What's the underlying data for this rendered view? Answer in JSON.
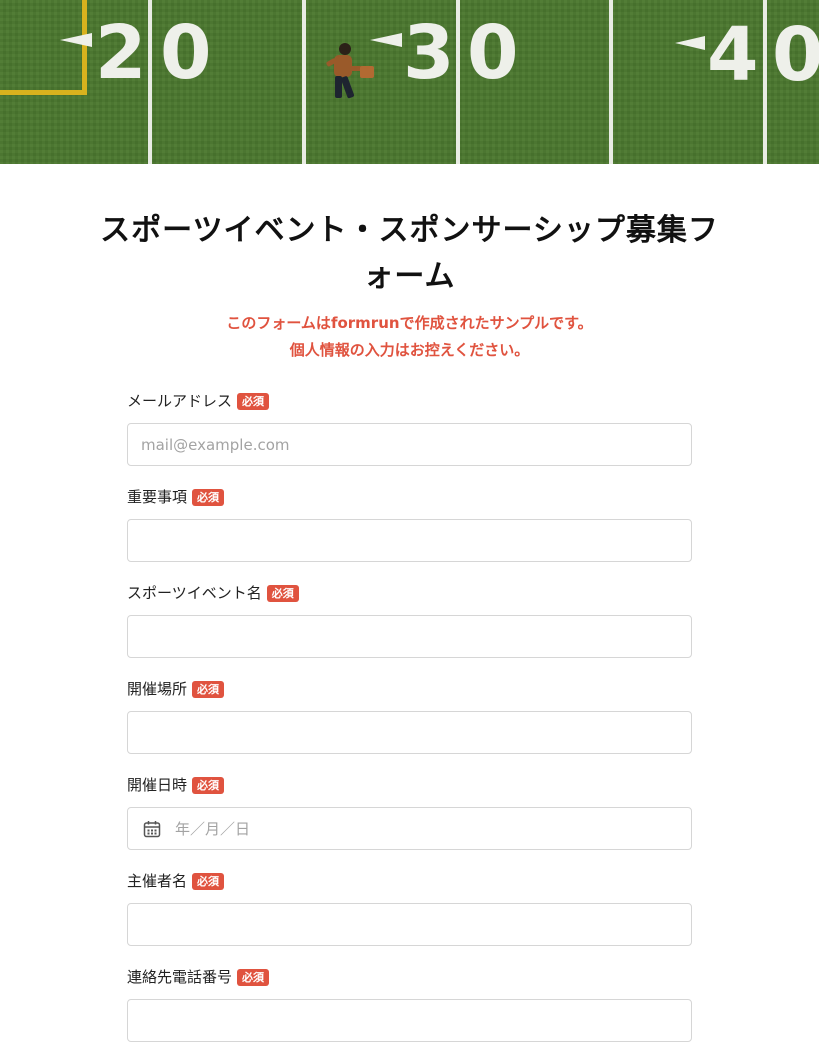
{
  "hero": {
    "yard_numbers": [
      "2",
      "0",
      "3",
      "0",
      "4",
      "0"
    ],
    "image_description_icon": "football-field-photo"
  },
  "header": {
    "title": "スポーツイベント・スポンサーシップ募集フォーム",
    "notice_line1_prefix": "このフォームは",
    "notice_line1_brand": "formrun",
    "notice_line1_suffix": "で作成されたサンプルです。",
    "notice_line2": "個人情報の入力はお控えください。"
  },
  "form": {
    "required_badge": "必須",
    "fields": [
      {
        "label": "メールアドレス",
        "placeholder": "mail@example.com",
        "type": "email"
      },
      {
        "label": "重要事項",
        "placeholder": "",
        "type": "text"
      },
      {
        "label": "スポーツイベント名",
        "placeholder": "",
        "type": "text"
      },
      {
        "label": "開催場所",
        "placeholder": "",
        "type": "text"
      },
      {
        "label": "開催日時",
        "placeholder": "年／月／日",
        "type": "date"
      },
      {
        "label": "主催者名",
        "placeholder": "",
        "type": "text"
      },
      {
        "label": "連絡先電話番号",
        "placeholder": "",
        "type": "tel"
      }
    ]
  },
  "colors": {
    "accent": "#e0533f",
    "field_border": "#d6d6d6",
    "turf": "#4a7530"
  }
}
